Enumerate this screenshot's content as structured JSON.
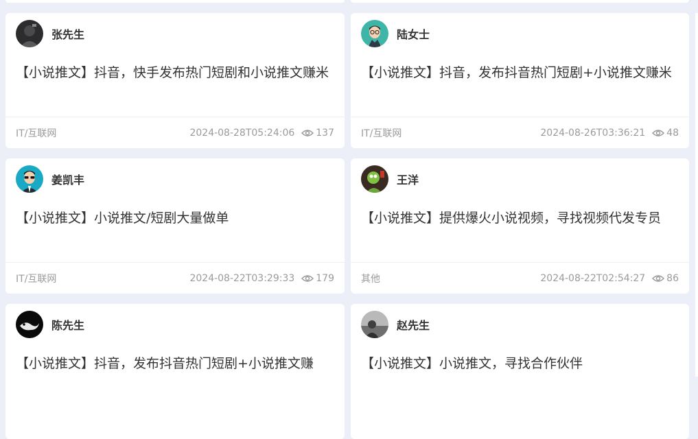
{
  "cards": [
    {
      "author": "张先生",
      "title": "【小说推文】抖音，快手发布热门短剧和小说推文赚米",
      "category": "IT/互联网",
      "date": "2024-08-28T05:24:06",
      "views": "137",
      "avatar_icon": "person-dark-photo-avatar"
    },
    {
      "author": "陆女士",
      "title": "【小说推文】抖音，发布抖音热门短剧+小说推文赚米",
      "category": "IT/互联网",
      "date": "2024-08-26T03:36:21",
      "views": "48",
      "avatar_icon": "cartoon-man-glasses-avatar"
    },
    {
      "author": "姜凯丰",
      "title": "【小说推文】小说推文/短剧大量做单",
      "category": "IT/互联网",
      "date": "2024-08-22T03:29:33",
      "views": "179",
      "avatar_icon": "cartoon-man-sunglasses-avatar"
    },
    {
      "author": "王洋",
      "title": "【小说推文】提供爆火小说视频，寻找视频代发专员",
      "category": "其他",
      "date": "2024-08-22T02:54:27",
      "views": "86",
      "avatar_icon": "green-character-photo-avatar"
    },
    {
      "author": "陈先生",
      "title": "【小说推文】抖音，发布抖音热门短剧+小说推文赚",
      "category": "",
      "date": "",
      "views": "",
      "avatar_icon": "black-white-logo-avatar"
    },
    {
      "author": "赵先生",
      "title": "【小说推文】小说推文，寻找合作伙伴",
      "category": "",
      "date": "",
      "views": "",
      "avatar_icon": "gray-landscape-photo-avatar"
    }
  ],
  "colors": {
    "background": "#eceff7",
    "card": "#ffffff",
    "text": "#333333",
    "muted": "#9a9a9a"
  }
}
